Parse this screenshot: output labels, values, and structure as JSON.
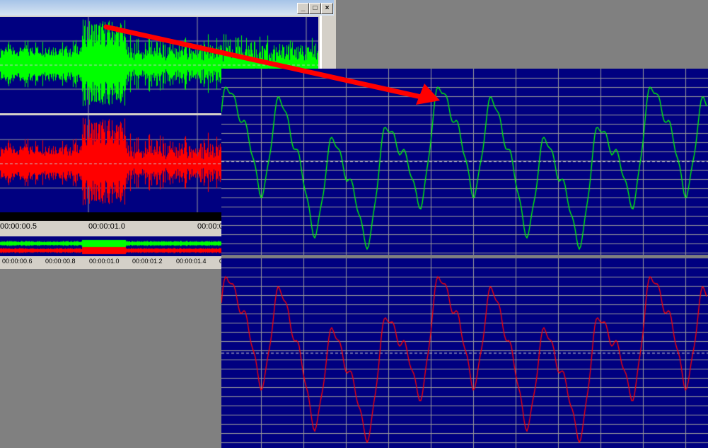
{
  "window": {
    "buttons": {
      "minimize": "_",
      "maximize": "□",
      "close": "×"
    }
  },
  "main_ruler": {
    "labels": [
      "00:00:00.5",
      "00:00:01.0",
      "00:00:0"
    ]
  },
  "overview_ruler": {
    "labels": [
      "00:00:00.6",
      "00:00:00.8",
      "00:00:01.0",
      "00:00:01.2",
      "00:00:01.4",
      "0"
    ]
  },
  "colors": {
    "background": "#000080",
    "left_channel": "#00ff00",
    "right_channel": "#ff0000",
    "grid": "#9a9a9a",
    "arrow": "#ff0000"
  }
}
